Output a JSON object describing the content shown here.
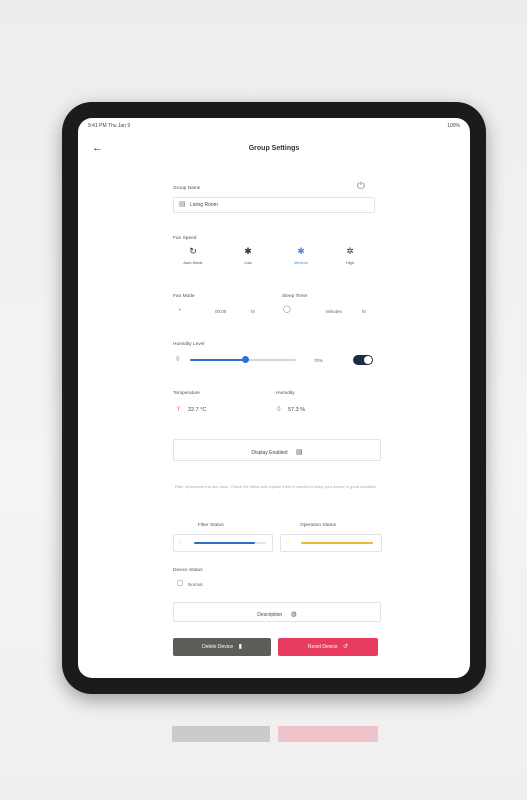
{
  "status": {
    "left": "9:41 PM  Thu Jan 9",
    "right": "100%"
  },
  "nav": {
    "back": "←",
    "title": "Group Settings"
  },
  "group_name": {
    "label": "Group Name",
    "value": "Living Room"
  },
  "fan_speed": {
    "label": "Fan Speed",
    "modes": [
      {
        "glyph": "↻",
        "label": "Auto Mode"
      },
      {
        "glyph": "✱",
        "label": "Low"
      },
      {
        "glyph": "✱",
        "label": "Medium"
      },
      {
        "glyph": "✲",
        "label": "High"
      }
    ],
    "active_index": 2
  },
  "fan_mode": {
    "label": "Fan Mode",
    "value": "00:00",
    "unit": "hr"
  },
  "sleep_timer": {
    "label": "Sleep Timer",
    "value": "Minutes",
    "unit": "hr"
  },
  "humidity_level": {
    "label": "Humidity Level",
    "value": "70%",
    "level": 0.52,
    "enabled": true
  },
  "temperature": {
    "label": "Temperature",
    "value": "22.7 °C"
  },
  "humidity": {
    "label": "Humidity",
    "value": "57.3 %"
  },
  "display_button": {
    "label": "Display Enabled"
  },
  "note": {
    "text": "Filter replacement is due soon. Check the filters and replace them if needed to keep your device in good condition."
  },
  "filter_status": {
    "label": "Filter Status",
    "level": 0.85
  },
  "operation_status": {
    "label": "Operation Status",
    "level": 1.0
  },
  "device_status": {
    "label": "Device Status",
    "value": "Normal"
  },
  "description_button": {
    "label": "Description"
  },
  "delete_button": {
    "label": "Delete Device"
  },
  "reset_button": {
    "label": "Reset Device"
  },
  "colors": {
    "accent": "#4a8de0",
    "slider": "#2e6fd6",
    "filter_bar": "#2d6ec4",
    "op_bar": "#e8b740",
    "delete": "#5c5c58",
    "reset": "#e83c5e",
    "toggle": "#1f2a44"
  }
}
